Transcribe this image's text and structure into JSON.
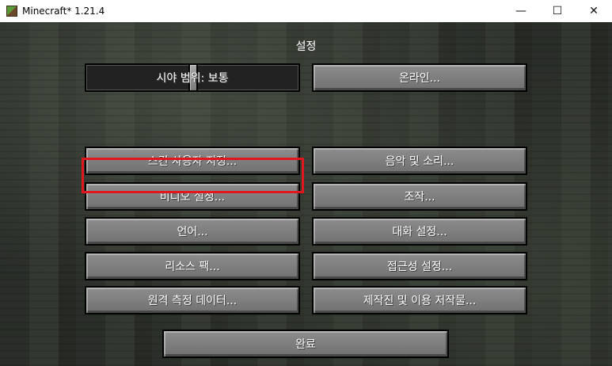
{
  "window": {
    "title": "Minecraft* 1.21.4",
    "controls": {
      "minimize": "—",
      "maximize": "☐",
      "close": "✕"
    }
  },
  "screen": {
    "title": "설정",
    "slider": {
      "label": "시야 범위: 보통"
    },
    "buttons": {
      "online": "온라인...",
      "skin": "스킨 사용자 지정...",
      "music": "음악 및 소리...",
      "video": "비디오 설정...",
      "controls": "조작...",
      "language": "언어...",
      "chat": "대화 설정...",
      "resource_packs": "리소스 팩...",
      "accessibility": "접근성 설정...",
      "telemetry": "원격 측정 데이터...",
      "credits": "제작진 및 이용 저작물...",
      "done": "완료"
    }
  },
  "highlight": {
    "target": "video",
    "color": "#e0181e"
  }
}
